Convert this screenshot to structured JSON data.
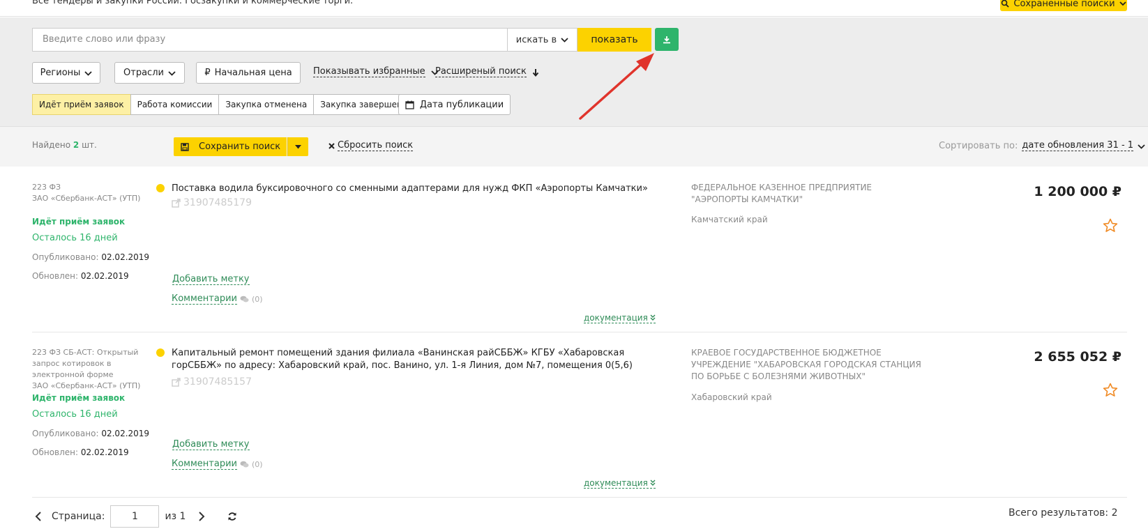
{
  "header": {
    "tagline": "Все тендеры и закупки России. Госзакупки и коммерческие торги.",
    "saved_searches": "Сохраненные поиски"
  },
  "search": {
    "placeholder": "Введите слово или фразу",
    "search_in": "искать в",
    "show": "показать"
  },
  "filters": {
    "regions": "Регионы",
    "industries": "Отрасли",
    "price": "Начальная цена",
    "show_favorites": "Показывать избранные",
    "advanced": "Расширеный поиск",
    "statuses": [
      "Идёт приём заявок",
      "Работа комиссии",
      "Закупка отменена",
      "Закупка завершена"
    ],
    "active_status": "Идёт приём заявок",
    "publish_date": "Дата публикации"
  },
  "summary": {
    "found_prefix": "Найдено",
    "found_count": "2",
    "found_suffix": "шт.",
    "save_search": "Сохранить поиск",
    "reset": "Сбросить поиск",
    "sort_label": "Сортировать по:",
    "sort_value": "дате обновления 31 - 1"
  },
  "results": [
    {
      "law": "223 ФЗ",
      "platform": "ЗАО «Сбербанк-АСТ» (УТП)",
      "status": "Идёт приём заявок",
      "remaining": "Осталось 16 дней",
      "published_label": "Опубликовано:",
      "published": "02.02.2019",
      "updated_label": "Обновлен:",
      "updated": "02.02.2019",
      "title": "Поставка водила буксировочного со сменными адаптерами для нужд ФКП «Аэропорты Камчатки»",
      "number": "31907485179",
      "add_tag": "Добавить метку",
      "comments": "Комментарии",
      "comments_count": "(0)",
      "documents": "документация",
      "customer": "ФЕДЕРАЛЬНОЕ КАЗЕННОЕ ПРЕДПРИЯТИЕ \"АЭРОПОРТЫ КАМЧАТКИ\"",
      "region": "Камчатский край",
      "price": "1 200 000 ₽"
    },
    {
      "law": "223 ФЗ СБ-АСТ: Открытый запрос котировок в электронной форме",
      "platform": "ЗАО «Сбербанк-АСТ» (УТП)",
      "status": "Идёт приём заявок",
      "remaining": "Осталось 16 дней",
      "published_label": "Опубликовано:",
      "published": "02.02.2019",
      "updated_label": "Обновлен:",
      "updated": "02.02.2019",
      "title": "Капитальный ремонт помещений здания филиала «Ванинская райСББЖ» КГБУ «Хабаровская горСББЖ» по адресу: Хабаровский край, пос. Ванино, ул. 1-я Линия, дом №7, помещения 0(5,6)",
      "number": "31907485157",
      "add_tag": "Добавить метку",
      "comments": "Комментарии",
      "comments_count": "(0)",
      "documents": "документация",
      "customer": "КРАЕВОЕ ГОСУДАРСТВЕННОЕ БЮДЖЕТНОЕ УЧРЕЖДЕНИЕ \"ХАБАРОВСКАЯ ГОРОДСКАЯ СТАНЦИЯ ПО БОРЬБЕ С БОЛЕЗНЯМИ ЖИВОТНЫХ\"",
      "region": "Хабаровский край",
      "price": "2 655 052 ₽"
    }
  ],
  "pagination": {
    "page_label": "Страница:",
    "page": "1",
    "of_label": "из 1",
    "total": "Всего результатов: 2"
  },
  "colors": {
    "accent_yellow": "#fcd200",
    "green": "#2eb46b",
    "annotation_arrow": "#e0342c"
  }
}
